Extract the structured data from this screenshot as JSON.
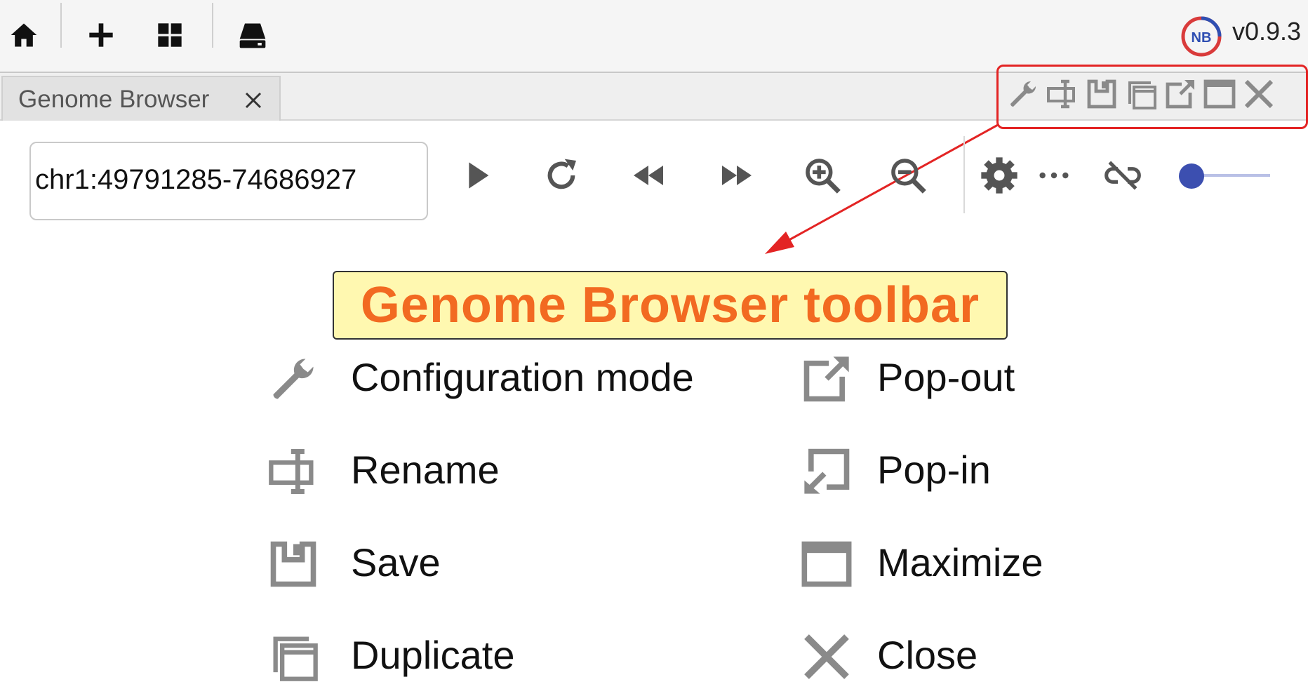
{
  "topbar": {
    "version": "v0.9.3",
    "logo_text": "NB",
    "buttons": [
      {
        "name": "home-icon"
      },
      {
        "name": "add-icon"
      },
      {
        "name": "grid-icon"
      },
      {
        "name": "storage-icon"
      }
    ]
  },
  "tab": {
    "title": "Genome Browser",
    "close_label": "×"
  },
  "window_controls": [
    {
      "name": "wrench-icon"
    },
    {
      "name": "rename-icon"
    },
    {
      "name": "save-icon"
    },
    {
      "name": "duplicate-icon"
    },
    {
      "name": "pop-out-icon"
    },
    {
      "name": "maximize-icon"
    },
    {
      "name": "close-icon"
    }
  ],
  "browser_toolbar": {
    "locus": "chr1:49791285-74686927",
    "controls": [
      "play-icon",
      "refresh-icon",
      "rewind-icon",
      "fast-forward-icon",
      "zoom-in-icon",
      "zoom-out-icon",
      "settings-icon",
      "more-icon",
      "unlink-icon"
    ]
  },
  "callout": {
    "text": "Genome Browser toolbar"
  },
  "legend": {
    "left": [
      {
        "icon": "wrench-icon",
        "label": "Configuration mode"
      },
      {
        "icon": "rename-icon",
        "label": "Rename"
      },
      {
        "icon": "save-icon",
        "label": "Save"
      },
      {
        "icon": "duplicate-icon",
        "label": "Duplicate"
      }
    ],
    "right": [
      {
        "icon": "pop-out-icon",
        "label": "Pop-out"
      },
      {
        "icon": "pop-in-icon",
        "label": "Pop-in"
      },
      {
        "icon": "maximize-icon",
        "label": "Maximize"
      },
      {
        "icon": "close-icon",
        "label": "Close"
      }
    ]
  },
  "colors": {
    "highlight": "#e32424",
    "callout_bg": "#fff8b0",
    "callout_text": "#f26a21",
    "icon_gray": "#8a8a8a",
    "slider": "#3c4fb0"
  }
}
